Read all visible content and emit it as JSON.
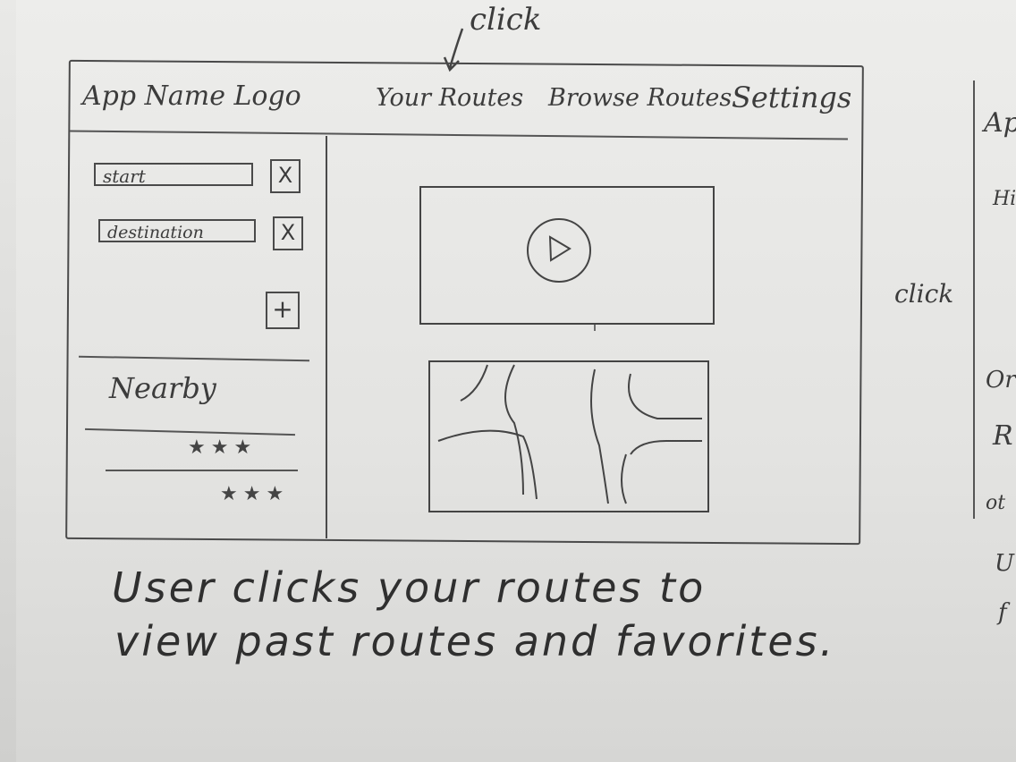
{
  "annotations": {
    "top_click": "click",
    "side_click": "click"
  },
  "nav": {
    "logo": "App Name Logo",
    "your_routes": "Your Routes",
    "browse_routes": "Browse Routes",
    "settings": "Settings"
  },
  "sidebar": {
    "start_placeholder": "start",
    "destination_placeholder": "destination",
    "remove_label": "X",
    "add_label": "+",
    "nearby_heading": "Nearby",
    "nearby_items": [
      {
        "stars": "★★★"
      },
      {
        "stars": "★★★"
      }
    ]
  },
  "main": {
    "video_play_icon": "play-icon",
    "map_icon": "map-sketch"
  },
  "caption": {
    "line1": "User clicks your routes to",
    "line2": "view past routes and favorites."
  },
  "right_page": {
    "fragments": [
      "Ap",
      "Hi",
      "Or",
      "R",
      "ot",
      "U",
      "f"
    ]
  },
  "colors": {
    "pencil": "#3c3c3c",
    "paper": "#e6e6e4"
  }
}
